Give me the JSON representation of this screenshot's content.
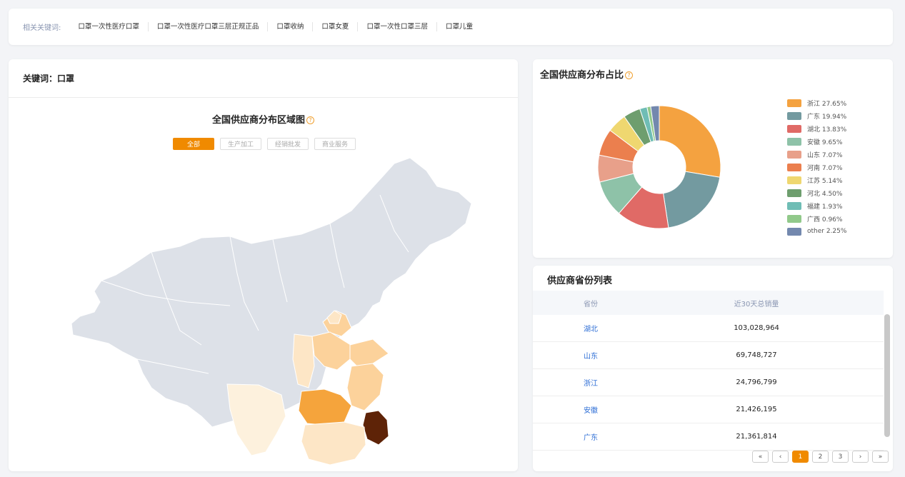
{
  "keywords": {
    "title": "相关关键词:",
    "items": [
      "口罩一次性医疗口罩",
      "口罩一次性医疗口罩三层正规正品",
      "口罩收纳",
      "口罩女夏",
      "口罩一次性口罩三层",
      "口罩儿童"
    ]
  },
  "map_card": {
    "header": "关键词：口罩",
    "title": "全国供应商分布区域图",
    "help_icon": "question-circle-icon",
    "filters": [
      "全部",
      "生产加工",
      "经销批发",
      "商业服务"
    ],
    "active_filter": 0
  },
  "pie_card": {
    "title": "全国供应商分布占比",
    "help_icon": "question-circle-icon"
  },
  "chart_data": {
    "type": "pie",
    "donut": true,
    "labels": [
      "浙江",
      "广东",
      "湖北",
      "安徽",
      "山东",
      "河南",
      "江苏",
      "河北",
      "福建",
      "广西",
      "other"
    ],
    "values": [
      27.65,
      19.94,
      13.83,
      9.65,
      7.07,
      7.07,
      5.14,
      4.5,
      1.93,
      0.96,
      2.25
    ],
    "legend_text": [
      "浙江 27.65%",
      "广东 19.94%",
      "湖北 13.83%",
      "安徽 9.65%",
      "山东 7.07%",
      "河南 7.07%",
      "江苏 5.14%",
      "河北 4.50%",
      "福建 1.93%",
      "广西 0.96%",
      "other 2.25%"
    ],
    "colors": [
      "#f4a240",
      "#739aa0",
      "#e06a66",
      "#8ec2a8",
      "#e8a08a",
      "#eb7f4e",
      "#efd770",
      "#6e9e6e",
      "#6fbdb5",
      "#91c98a",
      "#7388ae"
    ],
    "legend_position": "right"
  },
  "table": {
    "title": "供应商省份列表",
    "headers": [
      "省份",
      "近30天总销量"
    ],
    "rows": [
      [
        "湖北",
        "103,028,964"
      ],
      [
        "山东",
        "69,748,727"
      ],
      [
        "浙江",
        "24,796,799"
      ],
      [
        "安徽",
        "21,426,195"
      ],
      [
        "广东",
        "21,361,814"
      ]
    ],
    "pagination": [
      "«",
      "‹",
      "1",
      "2",
      "3",
      "›",
      "»"
    ],
    "current_page": "1"
  },
  "colors": {
    "accent": "#f08a00",
    "link": "#2f6fd6",
    "map_base": "#dde1e8",
    "map_zhejiang": "#5e2307",
    "map_guangdong": "#c0712c",
    "map_hubei": "#f5a43c",
    "map_light": "#fcd29b",
    "map_lighter": "#fde6c6",
    "map_lightest": "#fdf1dd"
  }
}
